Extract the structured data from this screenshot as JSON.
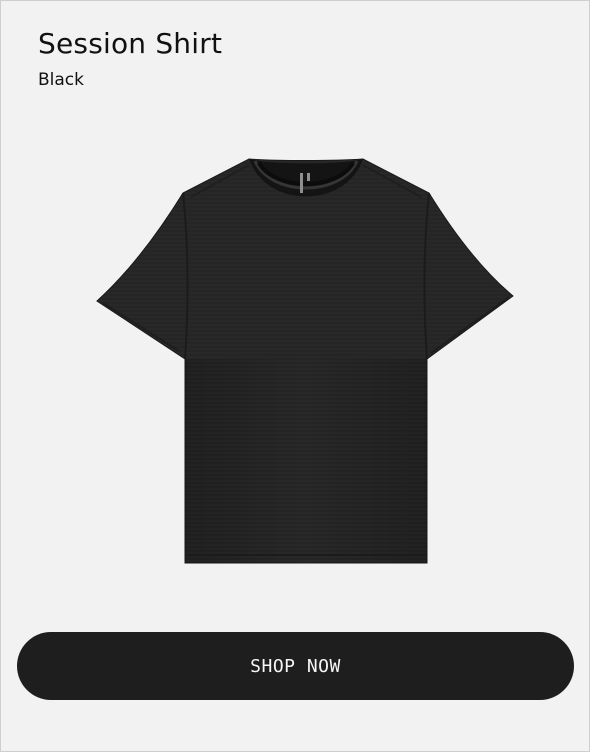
{
  "product": {
    "title": "Session Shirt",
    "color": "Black",
    "image_icon": "black-tshirt-image"
  },
  "cta": {
    "label": "SHOP NOW"
  },
  "colors": {
    "background": "#f2f2f2",
    "button": "#1e1e1e",
    "button_text": "#f5f5f5",
    "text": "#111111",
    "shirt": "#262626"
  }
}
